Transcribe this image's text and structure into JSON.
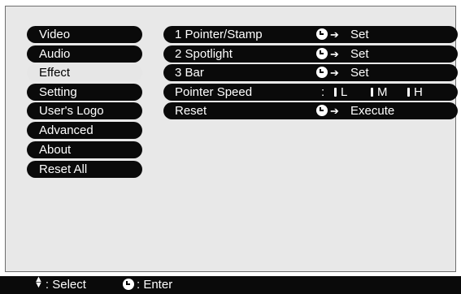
{
  "menu": {
    "items": [
      {
        "label": "Video",
        "active": false
      },
      {
        "label": "Audio",
        "active": false
      },
      {
        "label": "Effect",
        "active": true
      },
      {
        "label": "Setting",
        "active": false
      },
      {
        "label": "User's Logo",
        "active": false
      },
      {
        "label": "Advanced",
        "active": false
      },
      {
        "label": "About",
        "active": false
      },
      {
        "label": "Reset All",
        "active": false
      }
    ]
  },
  "effect": {
    "rows": [
      {
        "label": "1  Pointer/Stamp",
        "action": "Set",
        "action_icon": "enter-icon"
      },
      {
        "label": "2  Spotlight",
        "action": "Set",
        "action_icon": "enter-icon"
      },
      {
        "label": "3  Bar",
        "action": "Set",
        "action_icon": "enter-icon"
      },
      {
        "label": "Pointer Speed"
      },
      {
        "label": "Reset",
        "action": "Execute",
        "action_icon": "enter-icon"
      }
    ],
    "pointer_speed": {
      "separator": ":",
      "options": [
        "L",
        "M",
        "H"
      ]
    }
  },
  "footer": {
    "select_hint": ": Select",
    "enter_hint": ": Enter",
    "select_icon": "up-down-arrows-icon",
    "enter_icon": "enter-icon"
  },
  "colors": {
    "pill": "#0a0a0a",
    "highlight": "#e6e6e6",
    "background": "#e8e8e8",
    "text": "#ffffff"
  }
}
